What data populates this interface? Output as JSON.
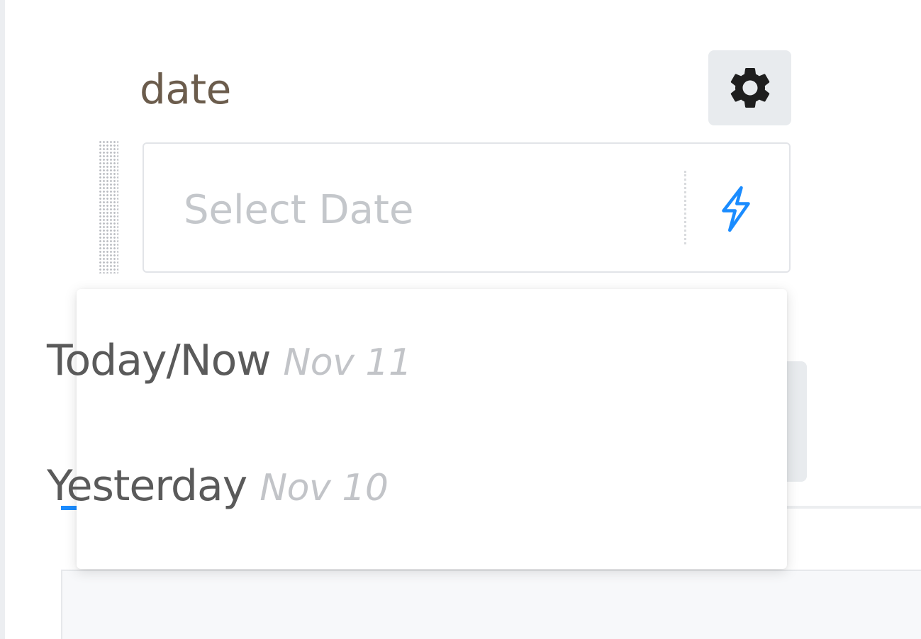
{
  "field": {
    "label": "date",
    "placeholder": "Select Date"
  },
  "icons": {
    "settings": "gear-icon",
    "quick_fill": "lightning-bolt-icon"
  },
  "colors": {
    "label": "#6b5c4c",
    "accent": "#1a8cff",
    "gear_button_bg": "#e8ebee"
  },
  "dropdown": {
    "options": [
      {
        "label": "Today/Now",
        "date": "Nov 11"
      },
      {
        "label": "Yesterday",
        "date": "Nov 10"
      }
    ]
  }
}
